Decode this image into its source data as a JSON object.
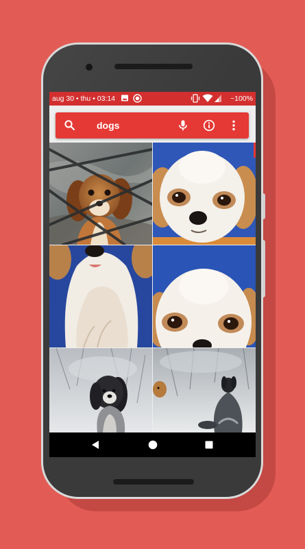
{
  "status_bar": {
    "left_text": "aug 30 • thu • 03:14",
    "battery": "~100%",
    "icons": [
      "image-icon",
      "record-icon",
      "vibrate-icon",
      "wifi-icon",
      "signal-icon"
    ]
  },
  "search": {
    "query": "dogs",
    "icons": [
      "search-icon",
      "microphone-icon",
      "info-icon",
      "more-vert-icon"
    ]
  },
  "results": {
    "images": [
      {
        "subject": "cavalier-puppy-behind-fence"
      },
      {
        "subject": "shih-tzu-face-blue-background"
      },
      {
        "subject": "shih-tzu-chest-blue-background"
      },
      {
        "subject": "shih-tzu-face-closeup"
      },
      {
        "subject": "spaniel-in-snow"
      },
      {
        "subject": "spaniel-in-snow-2"
      }
    ]
  },
  "nav_bar": {
    "buttons": [
      "back-icon",
      "home-icon",
      "recents-icon"
    ]
  },
  "colors": {
    "background": "#e25c55",
    "accent": "#e53935",
    "status_bar": "#d32f2f"
  }
}
